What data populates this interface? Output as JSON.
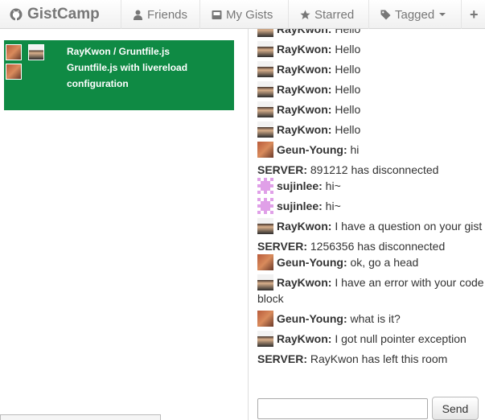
{
  "navbar": {
    "brand": "GistCamp",
    "brand_icon": "github-octocat-icon",
    "items": [
      {
        "label": "Friends",
        "icon": "user-icon"
      },
      {
        "label": "My Gists",
        "icon": "inbox-icon"
      },
      {
        "label": "Starred",
        "icon": "star-icon"
      },
      {
        "label": "Tagged",
        "icon": "tag-icon"
      }
    ],
    "plus": "+"
  },
  "gist": {
    "title": "RayKwon / Gruntfile.js",
    "description": "Gruntfile.js with livereload configuration",
    "color": "#0f8a44"
  },
  "chat": {
    "messages": [
      {
        "user": "RayKwon:",
        "text": " Hello",
        "avatar": "raykwon"
      },
      {
        "user": "RayKwon:",
        "text": " Hello",
        "avatar": "raykwon"
      },
      {
        "user": "RayKwon:",
        "text": " Hello",
        "avatar": "raykwon"
      },
      {
        "user": "RayKwon:",
        "text": " Hello",
        "avatar": "raykwon"
      },
      {
        "user": "RayKwon:",
        "text": " Hello",
        "avatar": "raykwon"
      },
      {
        "user": "RayKwon:",
        "text": " Hello",
        "avatar": "raykwon"
      },
      {
        "user": "Geun-Young:",
        "text": " hi",
        "avatar": "geun"
      },
      {
        "user": "SERVER:",
        "text": " 891212 has disconnected",
        "avatar": ""
      },
      {
        "user": "sujinlee:",
        "text": " hi~",
        "avatar": "suji"
      },
      {
        "user": "sujinlee:",
        "text": " hi~",
        "avatar": "suji"
      },
      {
        "user": "RayKwon:",
        "text": " I have a question on your gist",
        "avatar": "raykwon"
      },
      {
        "user": "SERVER:",
        "text": " 1256356 has disconnected",
        "avatar": ""
      },
      {
        "user": "Geun-Young:",
        "text": " ok, go a head",
        "avatar": "geun"
      },
      {
        "user": "RayKwon:",
        "text": " I have an error with your code block",
        "avatar": "raykwon"
      },
      {
        "user": "Geun-Young:",
        "text": " what is it?",
        "avatar": "geun"
      },
      {
        "user": "RayKwon:",
        "text": " I got null pointer exception",
        "avatar": "raykwon"
      },
      {
        "user": "SERVER:",
        "text": " RayKwon has left this room",
        "avatar": ""
      }
    ],
    "input_value": "",
    "send_label": "Send"
  }
}
